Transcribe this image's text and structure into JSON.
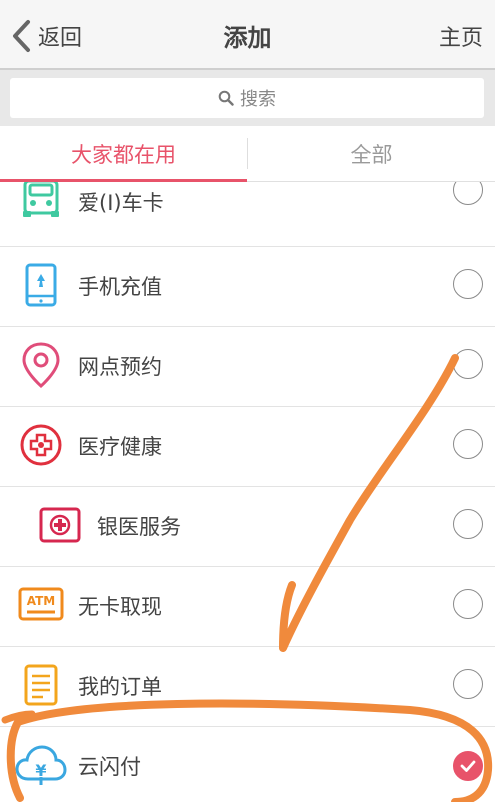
{
  "header": {
    "back_label": "返回",
    "title": "添加",
    "home_label": "主页"
  },
  "search": {
    "placeholder": "搜索"
  },
  "tabs": [
    {
      "label": "大家都在用",
      "active": true
    },
    {
      "label": "全部",
      "active": false
    }
  ],
  "items": [
    {
      "label": "爱(I)车卡",
      "icon": "car-icon",
      "checked": false
    },
    {
      "label": "手机充值",
      "icon": "phone-recharge-icon",
      "checked": false
    },
    {
      "label": "网点预约",
      "icon": "location-pin-icon",
      "checked": false
    },
    {
      "label": "医疗健康",
      "icon": "medical-cross-icon",
      "checked": false
    },
    {
      "label": "银医服务",
      "icon": "medical-kit-icon",
      "checked": false
    },
    {
      "label": "无卡取现",
      "icon": "atm-icon",
      "checked": false
    },
    {
      "label": "我的订单",
      "icon": "order-list-icon",
      "checked": false
    },
    {
      "label": "云闪付",
      "icon": "cloud-pay-icon",
      "checked": true
    }
  ],
  "icon_texts": {
    "atm": "ATM",
    "yuan": "¥"
  },
  "colors": {
    "accent": "#e8536a",
    "annotation": "#f08a3c"
  }
}
